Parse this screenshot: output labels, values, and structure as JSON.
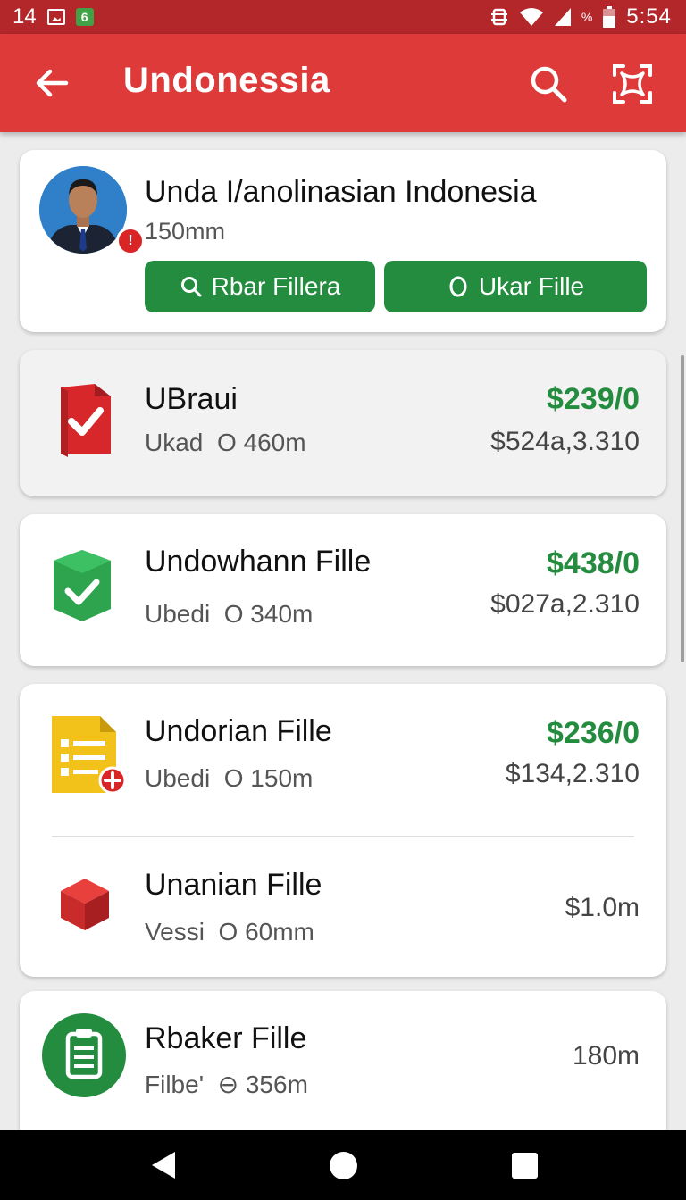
{
  "status_bar": {
    "left_number": "14",
    "badge": "6",
    "battery_text": "%",
    "time": "5:54"
  },
  "app_bar": {
    "title": "Undonessia",
    "icons": [
      "back-arrow-icon",
      "search-icon",
      "scan-icon"
    ]
  },
  "profile": {
    "name": "Unda I/anolinasian Indonesia",
    "subtitle": "150mm",
    "avatar_badge": "!",
    "button_1": "Rbar Fillera",
    "button_2": "Ukar Fille"
  },
  "files": [
    {
      "title": "UBraui",
      "meta_label": "Ukad",
      "meta_value": "460m",
      "price": "$239/0",
      "amount": "$524a,3.310",
      "icon": "red-check-document-icon"
    },
    {
      "title": "Undowhann Fille",
      "meta_label": "Ubedi",
      "meta_value": "340m",
      "price": "$438/0",
      "amount": "$027a,2.310",
      "icon": "green-check-shield-icon"
    },
    {
      "title": "Undorian Fille",
      "meta_label": "Ubedi",
      "meta_value": "150m",
      "price": "$236/0",
      "amount": "$134,2.310",
      "icon": "yellow-list-document-icon"
    },
    {
      "title": "Unanian Fille",
      "meta_label": "Vessi",
      "meta_value": "60mm",
      "price": "",
      "amount": "$1.0m",
      "icon": "red-box-icon"
    },
    {
      "title": "Rbaker Fille",
      "meta_label": "Filbe'",
      "meta_value": "356m",
      "price": "",
      "amount": "180m",
      "icon": "green-clipboard-icon"
    }
  ],
  "colors": {
    "status_bar": "#b3262a",
    "app_bar": "#de3a3a",
    "accent_green": "#238c3e",
    "red": "#d92525"
  },
  "nav_bar": [
    "back-triangle-icon",
    "home-circle-icon",
    "recents-square-icon"
  ]
}
